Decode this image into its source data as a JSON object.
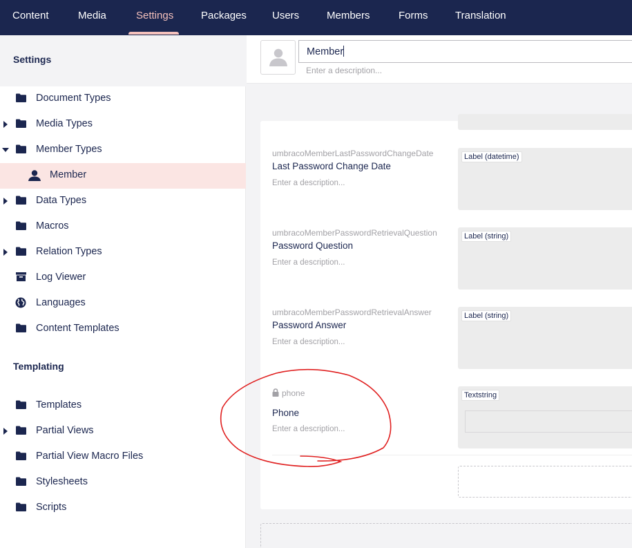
{
  "nav": {
    "items": [
      "Content",
      "Media",
      "Settings",
      "Packages",
      "Users",
      "Members",
      "Forms",
      "Translation"
    ],
    "active": "Settings"
  },
  "sidebar": {
    "title": "Settings",
    "settings_items": [
      {
        "label": "Document Types",
        "icon": "folder-icon",
        "expand": "none"
      },
      {
        "label": "Media Types",
        "icon": "folder-icon",
        "expand": "collapsed"
      },
      {
        "label": "Member Types",
        "icon": "folder-icon",
        "expand": "expanded"
      },
      {
        "label": "Member",
        "icon": "user-icon",
        "expand": "none",
        "selected": true
      },
      {
        "label": "Data Types",
        "icon": "folder-icon",
        "expand": "collapsed"
      },
      {
        "label": "Macros",
        "icon": "folder-icon",
        "expand": "none"
      },
      {
        "label": "Relation Types",
        "icon": "folder-icon",
        "expand": "collapsed"
      },
      {
        "label": "Log Viewer",
        "icon": "archive-icon",
        "expand": "none"
      },
      {
        "label": "Languages",
        "icon": "globe-icon",
        "expand": "none"
      },
      {
        "label": "Content Templates",
        "icon": "folder-icon",
        "expand": "none"
      }
    ],
    "templating_title": "Templating",
    "templating_items": [
      {
        "label": "Templates",
        "icon": "folder-icon",
        "expand": "none"
      },
      {
        "label": "Partial Views",
        "icon": "folder-icon",
        "expand": "collapsed"
      },
      {
        "label": "Partial View Macro Files",
        "icon": "folder-icon",
        "expand": "none"
      },
      {
        "label": "Stylesheets",
        "icon": "folder-icon",
        "expand": "none"
      },
      {
        "label": "Scripts",
        "icon": "folder-icon",
        "expand": "none"
      }
    ]
  },
  "header": {
    "name_value": "Member",
    "description_placeholder": "Enter a description..."
  },
  "properties": [
    {
      "alias": "umbracoMemberLastPasswordChangeDate",
      "name": "Last Password Change Date",
      "description": "Enter a description...",
      "editor": "Label (datetime)",
      "locked": false
    },
    {
      "alias": "umbracoMemberPasswordRetrievalQuestion",
      "name": "Password Question",
      "description": "Enter a description...",
      "editor": "Label (string)",
      "locked": false
    },
    {
      "alias": "umbracoMemberPasswordRetrievalAnswer",
      "name": "Password Answer",
      "description": "Enter a description...",
      "editor": "Label (string)",
      "locked": false
    },
    {
      "alias": "phone",
      "name": "Phone",
      "description": "Enter a description...",
      "editor": "Textstring",
      "locked": true
    }
  ],
  "colors": {
    "nav_bg": "#1b264f",
    "nav_active": "#f5c1bc",
    "selected_bg": "#fbe5e3",
    "annotation_red": "#e02020"
  }
}
